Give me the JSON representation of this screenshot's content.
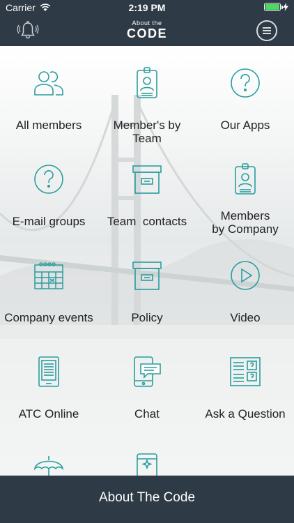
{
  "status_bar": {
    "carrier": "Carrier",
    "time": "2:19 PM"
  },
  "header": {
    "logo_small": "About the",
    "logo_big": "CODE"
  },
  "menu": [
    {
      "label": "All members",
      "icon": "people-icon"
    },
    {
      "label": "Member's by Team",
      "icon": "id-badge-icon"
    },
    {
      "label": "Our Apps",
      "icon": "question-icon"
    },
    {
      "label": "E-mail groups",
      "icon": "question-icon"
    },
    {
      "label": "Team  contacts",
      "icon": "archive-box-icon"
    },
    {
      "label": "Members\nby Company",
      "icon": "id-badge-icon"
    },
    {
      "label": "Company events",
      "icon": "calendar-icon"
    },
    {
      "label": "Policy",
      "icon": "archive-box-icon"
    },
    {
      "label": "Video",
      "icon": "play-icon"
    },
    {
      "label": "ATC Online",
      "icon": "ereader-icon"
    },
    {
      "label": "Chat",
      "icon": "chat-phone-icon"
    },
    {
      "label": "Ask a Question",
      "icon": "qa-book-icon"
    },
    {
      "label": "",
      "icon": "umbrella-icon"
    },
    {
      "label": "",
      "icon": "phone-sparkle-icon"
    }
  ],
  "footer": {
    "label": "About The Code"
  },
  "colors": {
    "accent": "#2a9d9d",
    "bar": "#2e3a45"
  }
}
